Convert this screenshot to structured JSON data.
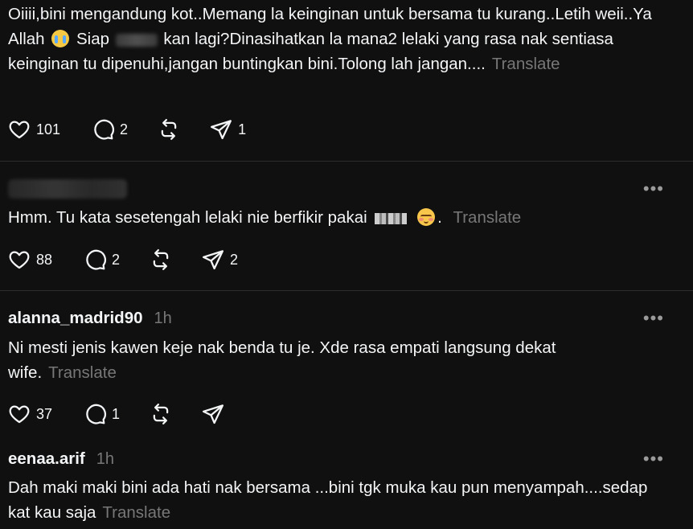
{
  "posts": [
    {
      "text_parts": [
        "Oiiii,bini mengandung kot..Memang la keinginan untuk bersama tu kurang..Letih weii..Ya Allah ",
        " Siap ",
        " kan lagi?Dinasihatkan la mana2 lelaki yang rasa nak sentiasa keinginan tu dipenuhi,jangan buntingkan bini.Tolong lah jangan...."
      ],
      "translate": "Translate",
      "likes": "101",
      "replies": "2",
      "shares": "1"
    },
    {
      "text_parts": [
        "Hmm. Tu kata sesetengah lelaki nie berfikir pakai ",
        " ",
        ". "
      ],
      "translate": "Translate",
      "likes": "88",
      "replies": "2",
      "shares": "2"
    },
    {
      "username": "alanna_madrid90",
      "time": "1h",
      "text": "Ni mesti jenis kawen keje nak benda tu je. Xde rasa empati langsung dekat wife.",
      "translate": "Translate",
      "likes": "37",
      "replies": "1"
    },
    {
      "username": "eenaa.arif",
      "time": "1h",
      "text": "Dah maki maki bini ada hati nak bersama ...bini tgk muka kau pun menyampah....sedap kat kau saja",
      "translate": "Translate"
    }
  ],
  "more_label": "•••",
  "icons": {
    "like": "heart-icon",
    "reply": "comment-icon",
    "repost": "repost-icon",
    "share": "send-icon",
    "more": "more-options-icon"
  },
  "colors": {
    "background": "#101010",
    "text": "#f3f5f7",
    "muted": "#777777",
    "divider": "#2d2d2d"
  }
}
